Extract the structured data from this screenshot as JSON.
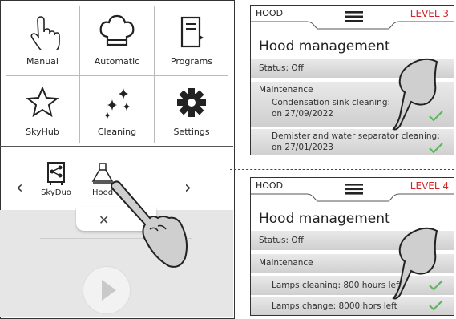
{
  "menu": {
    "items": [
      {
        "label": "Manual",
        "icon": "hand-pointer-icon"
      },
      {
        "label": "Automatic",
        "icon": "chef-hat-icon"
      },
      {
        "label": "Programs",
        "icon": "recipe-book-icon"
      },
      {
        "label": "SkyHub",
        "icon": "star-icon"
      },
      {
        "label": "Cleaning",
        "icon": "sparkles-icon"
      },
      {
        "label": "Settings",
        "icon": "gear-icon"
      }
    ]
  },
  "carousel": {
    "items": [
      {
        "label": "SkyDuo",
        "icon": "skyduo-share-icon"
      },
      {
        "label": "Hood",
        "icon": "hood-icon"
      }
    ],
    "prev": "‹",
    "next": "›",
    "close": "✕"
  },
  "panel_top": {
    "name": "HOOD",
    "level": "LEVEL 3",
    "title": "Hood management",
    "status": "Status: Off",
    "section": "Maintenance",
    "items": [
      {
        "line1": "Condensation sink cleaning:",
        "line2": "on 27/09/2022"
      },
      {
        "line1": "Demister and water separator cleaning:",
        "line2": "on 27/01/2023"
      }
    ]
  },
  "panel_bottom": {
    "name": "HOOD",
    "level": "LEVEL 4",
    "title": "Hood management",
    "status": "Status: Off",
    "section": "Maintenance",
    "items": [
      {
        "line1": "Lamps cleaning: 800 hours left"
      },
      {
        "line1": "Lamps change: 8000 hors left"
      }
    ]
  },
  "colors": {
    "accent": "#d0262a",
    "check": "#5cb85c",
    "row_bg": "#d8d8d8"
  }
}
